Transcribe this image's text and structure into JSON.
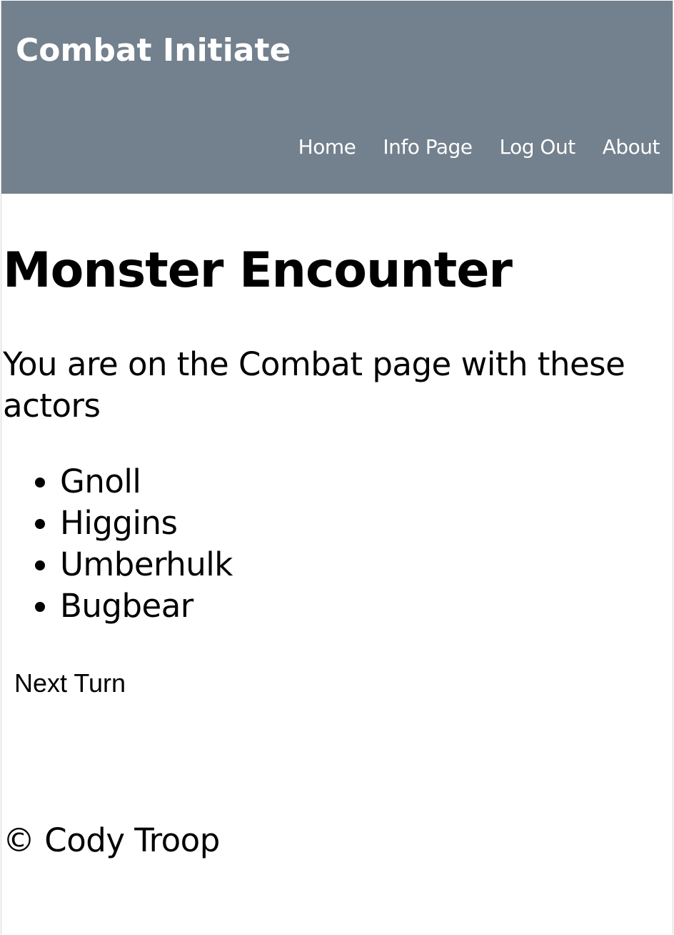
{
  "header": {
    "brand": "Combat Initiate",
    "nav": [
      {
        "label": "Home"
      },
      {
        "label": "Info Page"
      },
      {
        "label": "Log Out"
      },
      {
        "label": "About"
      }
    ]
  },
  "main": {
    "title": "Monster Encounter",
    "intro": "You are on the Combat page with these actors",
    "actors": [
      "Gnoll",
      "Higgins",
      "Umberhulk",
      "Bugbear"
    ],
    "next_turn_label": "Next Turn"
  },
  "footer": {
    "text": "© Cody Troop"
  },
  "colors": {
    "header_bg": "#73808d",
    "header_text": "#ffffff",
    "body_text": "#000000"
  }
}
